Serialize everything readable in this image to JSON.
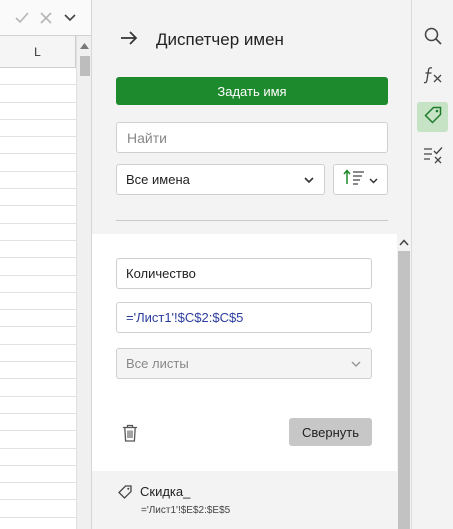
{
  "sheet": {
    "column_label": "L"
  },
  "panel": {
    "title": "Диспетчер имен",
    "define_name_label": "Задать имя",
    "search_placeholder": "Найти",
    "filter_selected": "Все имена"
  },
  "editor": {
    "name_value": "Количество",
    "reference_value": "='Лист1'!$C$2:$C$5",
    "scope_value": "Все листы",
    "collapse_label": "Свернуть"
  },
  "names_list": [
    {
      "name": "Скидка_",
      "reference": "='Лист1'!$E$2:$E$5"
    }
  ],
  "colors": {
    "accent": "#1e8a2e",
    "reference_text": "#2c3d9e",
    "active_tool": "#c6e3c6"
  },
  "icons": {
    "formula_bar": [
      "check-icon",
      "close-icon",
      "chevron-down-icon"
    ],
    "rail": [
      "search-icon",
      "function-icon",
      "tag-icon",
      "checklist-icon"
    ]
  }
}
